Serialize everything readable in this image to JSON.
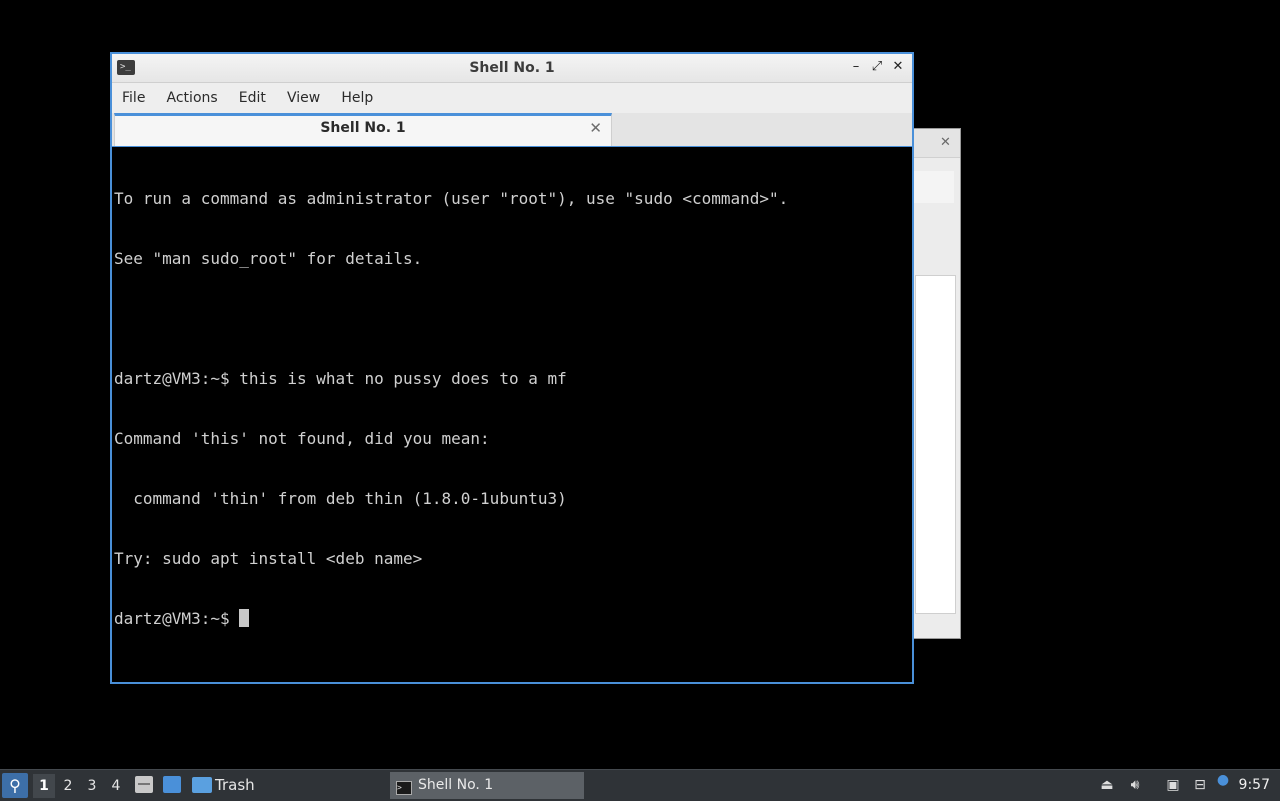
{
  "window": {
    "title": "Shell No. 1",
    "controls": {
      "minimize": "–",
      "maximize": "⤢",
      "close": "✕"
    }
  },
  "menubar": {
    "items": [
      "File",
      "Actions",
      "Edit",
      "View",
      "Help"
    ]
  },
  "tabs": [
    {
      "label": "Shell No. 1",
      "close": "✕"
    }
  ],
  "terminal": {
    "lines": [
      "To run a command as administrator (user \"root\"), use \"sudo <command>\".",
      "See \"man sudo_root\" for details.",
      "",
      "dartz@VM3:~$ this is what no pussy does to a mf",
      "Command 'this' not found, did you mean:",
      "  command 'thin' from deb thin (1.8.0-1ubuntu3)",
      "Try: sudo apt install <deb name>",
      "dartz@VM3:~$ "
    ]
  },
  "taskbar": {
    "workspaces": [
      "1",
      "2",
      "3",
      "4"
    ],
    "active_workspace": "1",
    "trash_label": "Trash",
    "task_label": "Shell No. 1",
    "clock": "9:57"
  },
  "colors": {
    "accent": "#4a90d9",
    "terminal_bg": "#000000",
    "terminal_fg": "#d0d0d0",
    "taskbar_bg": "#2f3337"
  }
}
